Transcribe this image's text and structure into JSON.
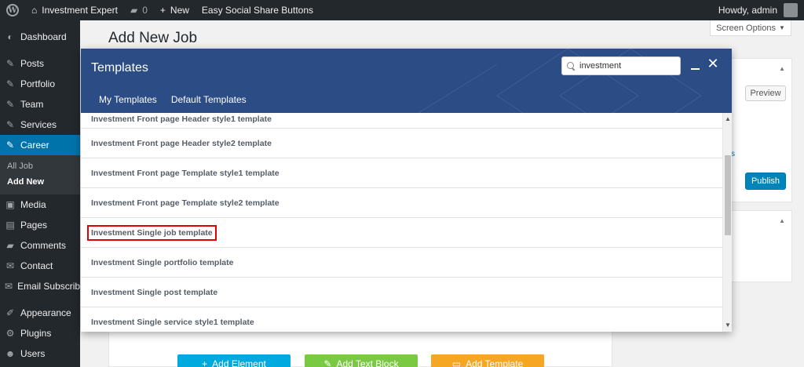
{
  "admin_bar": {
    "site_name": "Investment Expert",
    "comments_count": "0",
    "new_label": "New",
    "plugin_label": "Easy Social Share Buttons",
    "howdy": "Howdy, admin"
  },
  "sidebar": {
    "items": [
      {
        "label": "Dashboard",
        "icon": "dashboard-icon"
      },
      {
        "label": "Posts",
        "icon": "pin-icon"
      },
      {
        "label": "Portfolio",
        "icon": "pin-icon"
      },
      {
        "label": "Team",
        "icon": "pin-icon"
      },
      {
        "label": "Services",
        "icon": "pin-icon"
      },
      {
        "label": "Career",
        "icon": "pin-icon"
      },
      {
        "label": "Media",
        "icon": "media-icon"
      },
      {
        "label": "Pages",
        "icon": "pages-icon"
      },
      {
        "label": "Comments",
        "icon": "comments-icon"
      },
      {
        "label": "Contact",
        "icon": "mail-icon"
      },
      {
        "label": "Email Subscribers",
        "icon": "mail-icon"
      },
      {
        "label": "Appearance",
        "icon": "brush-icon"
      },
      {
        "label": "Plugins",
        "icon": "plugin-icon"
      },
      {
        "label": "Users",
        "icon": "users-icon"
      }
    ],
    "submenu": {
      "all_job": "All Job",
      "add_new": "Add New"
    }
  },
  "main": {
    "page_title": "Add New Job",
    "screen_options": "Screen Options",
    "preview_label": "Preview",
    "publish_label": "Publish",
    "bottom_buttons": {
      "add_element": "Add Element",
      "add_text_block": "Add Text Block",
      "add_template": "Add Template"
    }
  },
  "modal": {
    "title": "Templates",
    "search_value": "investment",
    "tabs": [
      "My Templates",
      "Default Templates"
    ],
    "templates": [
      "Investment Front page Header style1 template",
      "Investment Front page Header style2 template",
      "Investment Front page Template style1 template",
      "Investment Front page Template style2 template",
      "Investment Single job template",
      "Investment Single portfolio template",
      "Investment Single post template",
      "Investment Single service style1 template"
    ],
    "highlighted_template": "Investment Single job template"
  },
  "colors": {
    "admin_dark": "#23282d",
    "active_blue": "#0073aa",
    "modal_header": "#2b4c85",
    "highlight_red": "#e00000",
    "add_element": "#00aadf",
    "add_text_block": "#7ac943",
    "add_template": "#f5a623"
  }
}
